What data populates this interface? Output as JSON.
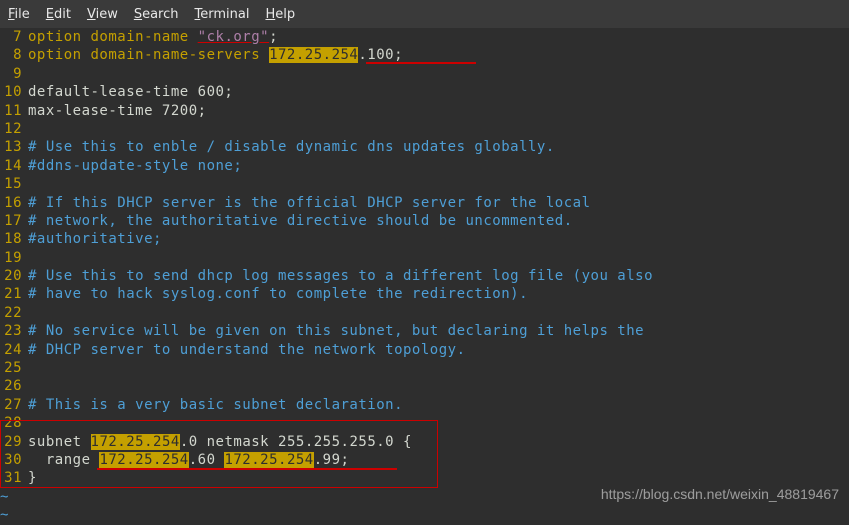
{
  "menu": {
    "file": "File",
    "edit": "Edit",
    "view": "View",
    "search": "Search",
    "terminal": "Terminal",
    "help": "Help"
  },
  "gutter": [
    "7",
    "8",
    "9",
    "10",
    "11",
    "12",
    "13",
    "14",
    "15",
    "16",
    "17",
    "18",
    "19",
    "20",
    "21",
    "22",
    "23",
    "24",
    "25",
    "26",
    "27",
    "28",
    "29",
    "30",
    "31"
  ],
  "lines": {
    "l7_pre": "option domain-name ",
    "l7_str": "\"ck.org\"",
    "l7_post": ";",
    "l8_pre": "option domain-name-servers ",
    "l8_hl": "172.25.254",
    "l8_post": ".100;",
    "l10": "default-lease-time 600;",
    "l11": "max-lease-time 7200;",
    "l13": "# Use this to enble / disable dynamic dns updates globally.",
    "l14": "#ddns-update-style none;",
    "l16": "# If this DHCP server is the official DHCP server for the local",
    "l17": "# network, the authoritative directive should be uncommented.",
    "l18": "#authoritative;",
    "l20": "# Use this to send dhcp log messages to a different log file (you also",
    "l21": "# have to hack syslog.conf to complete the redirection).",
    "l23": "# No service will be given on this subnet, but declaring it helps the",
    "l24": "# DHCP server to understand the network topology.",
    "l27": "# This is a very basic subnet declaration.",
    "l29_a": "subnet ",
    "l29_hl1": "172.25.254",
    "l29_b": ".0 netmask 255.255.255.0 {",
    "l30_a": "  range ",
    "l30_hl1": "172.25.254",
    "l30_b": ".60 ",
    "l30_hl2": "172.25.254",
    "l30_c": ".99;",
    "l31": "}",
    "tilde": "~"
  },
  "watermark": "https://blog.csdn.net/weixin_48819467"
}
